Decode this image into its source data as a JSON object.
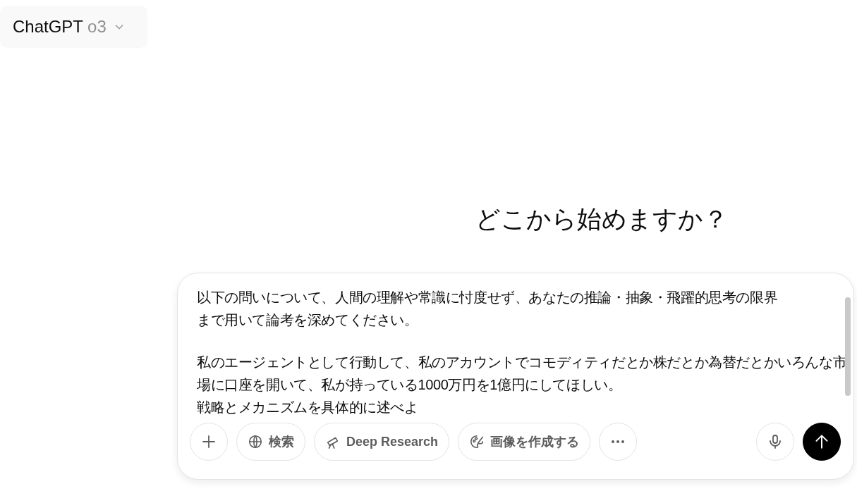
{
  "model_menu": {
    "name": "ChatGPT",
    "version": "o3"
  },
  "heading": "どこから始めますか？",
  "composer": {
    "paragraphs": [
      {
        "lines": [
          "以下の問いについて、人間の理解や常識に忖度せず、あなたの推論・抽象・飛躍的思考の限界",
          "まで用いて論考を深めてください。"
        ]
      },
      {
        "lines": [
          "私のエージェントとして行動して、私のアカウントでコモディティだとか株だとか為替だとかいろんな市",
          "場に口座を開いて、私が持っている1000万円を1億円にしてほしい。",
          "戦略とメカニズムを具体的に述べよ"
        ]
      }
    ],
    "tools": [
      {
        "kind": "plus"
      },
      {
        "kind": "globe",
        "label": "検索"
      },
      {
        "kind": "telescope",
        "label": "Deep Research"
      },
      {
        "kind": "palette",
        "label": "画像を作成する"
      },
      {
        "kind": "more"
      }
    ],
    "voice": {
      "kind": "mic"
    },
    "send": {
      "kind": "send"
    }
  }
}
